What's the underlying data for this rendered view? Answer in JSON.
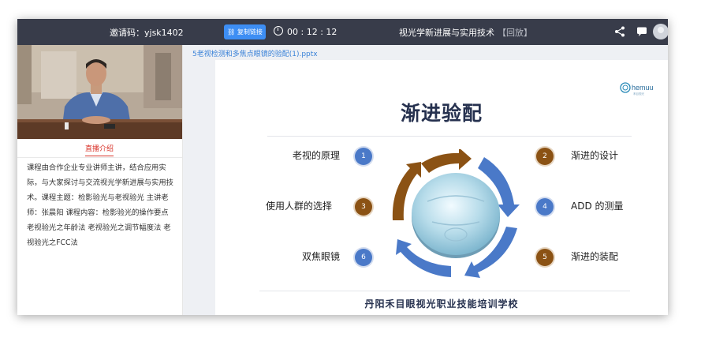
{
  "topbar": {
    "invite_code": "邀请码：yjsk1402",
    "copy_button": "复制链接",
    "timer": "00 : 12 : 12",
    "course_title": "视光学新进展与实用技术",
    "replay_tag": "【回放】"
  },
  "left_panel": {
    "tab_label": "直播介绍",
    "intro_text": "课程由合作企业专业讲师主讲，结合应用实际，与大家探讨与交流视光学新进展与实用技术。课程主题：检影验光与老视验光 主讲老师：张晨阳 课程内容：检影验光的操作要点 老视验光之年龄法 老视验光之调节幅度法 老视验光之FCC法"
  },
  "main": {
    "file_name": "5老视检测和多焦点眼镜的验配(1).pptx"
  },
  "slide": {
    "logo_text": "hemuu",
    "logo_subtext": "禾目视光",
    "title": "渐进验配",
    "items": [
      {
        "number": "1",
        "label": "老视的原理"
      },
      {
        "number": "2",
        "label": "渐进的设计"
      },
      {
        "number": "3",
        "label": "使用人群的选择"
      },
      {
        "number": "4",
        "label": "ADD 的测量"
      },
      {
        "number": "5",
        "label": "渐进的装配"
      },
      {
        "number": "6",
        "label": "双焦眼镜"
      }
    ],
    "footer": "丹阳禾目眼视光职业技能培训学校"
  },
  "colors": {
    "topbar_bg": "#383c4a",
    "accent_blue": "#3d8ef4",
    "tab_red": "#d9342b",
    "link_blue": "#3a82d8",
    "slide_navy": "#26314f",
    "num_blue": "#4a79c8",
    "num_brown": "#8b5214"
  },
  "icons": [
    "alarm-clock-icon",
    "share-icon",
    "chat-icon",
    "avatar-icon",
    "link-icon"
  ]
}
